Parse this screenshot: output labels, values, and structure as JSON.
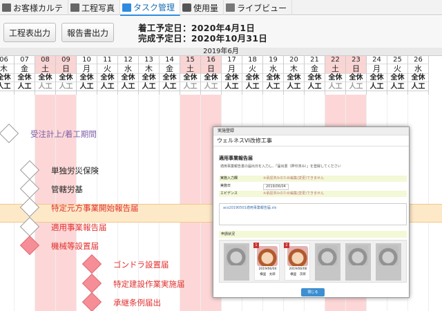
{
  "tabs": [
    {
      "label": "お客様カルテ",
      "icon": "customer-chart-icon"
    },
    {
      "label": "工程写真",
      "icon": "camera-icon"
    },
    {
      "label": "タスク管理",
      "icon": "task-icon"
    },
    {
      "label": "使用量",
      "icon": "usage-icon"
    },
    {
      "label": "ライブビュー",
      "icon": "live-view-icon"
    }
  ],
  "active_tab_index": 2,
  "toolbar": {
    "process_output": "工程表出力",
    "report_output": "報告書出力",
    "start_label": "着工予定日：",
    "start_date": "2020年4月1日",
    "end_label": "完成予定日：",
    "end_date": "2020年10月31日"
  },
  "calendar": {
    "month": "2019年6月",
    "days": [
      {
        "d": "06",
        "w": "木",
        "z": "全休",
        "j": "人工",
        "hol": false
      },
      {
        "d": "07",
        "w": "金",
        "z": "全休",
        "j": "人工",
        "hol": false
      },
      {
        "d": "08",
        "w": "土",
        "z": "全休",
        "j": "人工",
        "hol": true
      },
      {
        "d": "09",
        "w": "日",
        "z": "全休",
        "j": "人工",
        "hol": true
      },
      {
        "d": "10",
        "w": "月",
        "z": "全休",
        "j": "人工",
        "hol": false
      },
      {
        "d": "11",
        "w": "火",
        "z": "全休",
        "j": "人工",
        "hol": false
      },
      {
        "d": "12",
        "w": "水",
        "z": "全休",
        "j": "人工",
        "hol": false
      },
      {
        "d": "13",
        "w": "木",
        "z": "全休",
        "j": "人工",
        "hol": false
      },
      {
        "d": "14",
        "w": "金",
        "z": "全休",
        "j": "人工",
        "hol": false
      },
      {
        "d": "15",
        "w": "土",
        "z": "全休",
        "j": "人工",
        "hol": true
      },
      {
        "d": "16",
        "w": "日",
        "z": "全休",
        "j": "人工",
        "hol": true
      },
      {
        "d": "17",
        "w": "月",
        "z": "全休",
        "j": "人工",
        "hol": false
      },
      {
        "d": "18",
        "w": "火",
        "z": "全休",
        "j": "人工",
        "hol": false
      },
      {
        "d": "19",
        "w": "水",
        "z": "全休",
        "j": "人工",
        "hol": false
      },
      {
        "d": "20",
        "w": "木",
        "z": "全休",
        "j": "人工",
        "hol": false
      },
      {
        "d": "21",
        "w": "金",
        "z": "全休",
        "j": "人工",
        "hol": false
      },
      {
        "d": "22",
        "w": "土",
        "z": "全休",
        "j": "人工",
        "hol": true
      },
      {
        "d": "23",
        "w": "日",
        "z": "全休",
        "j": "人工",
        "hol": true
      },
      {
        "d": "24",
        "w": "月",
        "z": "全休",
        "j": "人工",
        "hol": false
      },
      {
        "d": "25",
        "w": "火",
        "z": "全休",
        "j": "人工",
        "hol": false
      },
      {
        "d": "26",
        "w": "水",
        "z": "全休",
        "j": "人工",
        "hol": false
      }
    ]
  },
  "tasks": [
    {
      "label": "受注計上/着工期間",
      "color": "#7b5ea7",
      "marker": "white"
    },
    {
      "label": "単独労災保険",
      "color": "#222222",
      "marker": "white"
    },
    {
      "label": "管轄労基",
      "color": "#222222",
      "marker": "white"
    },
    {
      "label": "特定元方事業開始報告届",
      "color": "#e0312f",
      "marker": "white",
      "highlight": true
    },
    {
      "label": "適用事業報告届",
      "color": "#e0312f",
      "marker": "white"
    },
    {
      "label": "機械等設置届",
      "color": "#e0312f",
      "marker": "red"
    },
    {
      "label": "ゴンドラ設置届",
      "color": "#e0312f",
      "marker": "red"
    },
    {
      "label": "特定建設作業実施届",
      "color": "#e0312f",
      "marker": "red"
    },
    {
      "label": "承継条例届出",
      "color": "#e0312f",
      "marker": "red"
    }
  ],
  "modal": {
    "header": "実施登録",
    "project": "ウェルネスVI改修工事",
    "section": "適用事業報告届",
    "description": "適用事業報告書の届出日を入力し、「届出書（押印済み）」を登録してください",
    "rows": [
      {
        "key": "実施入力欄",
        "value": "※承認済みのため編集(変更)できません"
      },
      {
        "key": "実施日",
        "value": "2019/06/04"
      },
      {
        "key": "エビデンス",
        "value": "※承認済みのため編集(変更)できません"
      }
    ],
    "file": "acs20190501適用事業報告届.xls",
    "status_label": "申請状況",
    "cards": [
      {
        "date": "",
        "name": "",
        "active": false
      },
      {
        "date": "2019/06/04",
        "name": "横里　太郎",
        "active": true,
        "badge": "1"
      },
      {
        "date": "2019/06/06",
        "name": "横里　次郎",
        "active": true,
        "badge": "2"
      },
      {
        "date": "",
        "name": "",
        "active": false
      },
      {
        "date": "",
        "name": "",
        "active": false
      },
      {
        "date": "",
        "name": "",
        "active": false
      }
    ],
    "close": "閉じる"
  }
}
